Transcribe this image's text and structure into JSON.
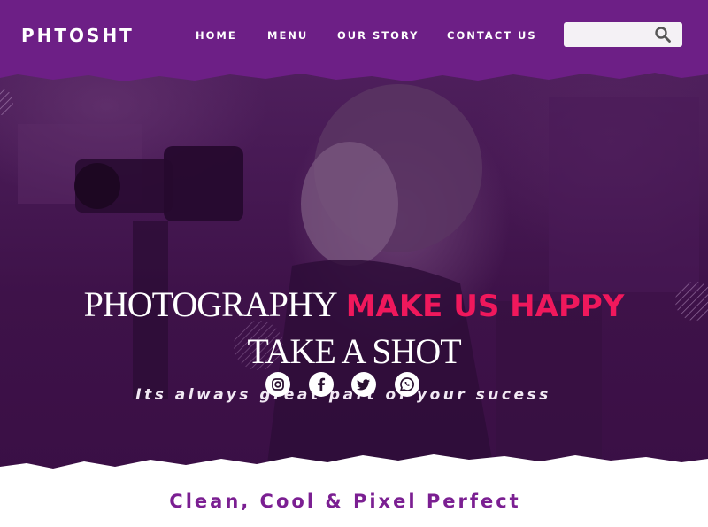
{
  "header": {
    "logo": "PHTOSHT",
    "nav": [
      {
        "label": "HOME"
      },
      {
        "label": "MENU"
      },
      {
        "label": "OUR STORY"
      },
      {
        "label": "CONTACT US"
      }
    ],
    "search": {
      "value": "",
      "placeholder": "",
      "icon": "search-icon"
    }
  },
  "hero": {
    "headline_part1": "PHOTOGRAPHY",
    "headline_part2": "MAKE US HAPPY",
    "headline_line2": "TAKE A SHOT",
    "tagline": "Its always great part of your sucess",
    "social": [
      {
        "icon": "instagram-icon"
      },
      {
        "icon": "facebook-icon"
      },
      {
        "icon": "twitter-icon"
      },
      {
        "icon": "whatsapp-icon"
      }
    ]
  },
  "section": {
    "title": "Clean, Cool & Pixel Perfect"
  },
  "colors": {
    "header_bg": "#6d1f86",
    "accent": "#f0185c",
    "hero_overlay": "#3e1249",
    "section_title": "#7b1f92"
  }
}
